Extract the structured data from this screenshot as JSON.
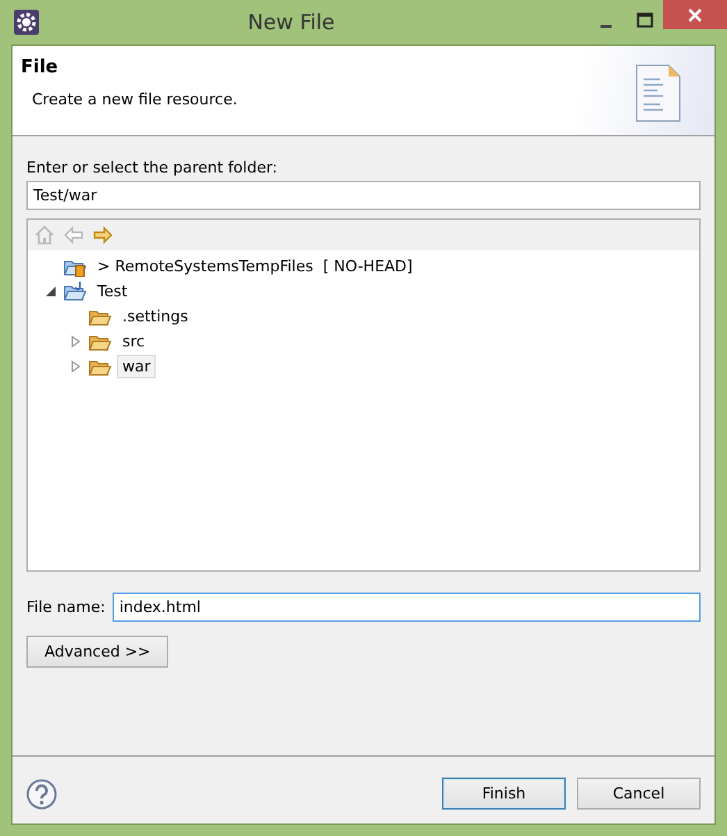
{
  "window": {
    "title": "New File"
  },
  "header": {
    "title": "File",
    "description": "Create a new file resource."
  },
  "parent_folder": {
    "label": "Enter or select the parent folder:",
    "value": "Test/war"
  },
  "tree": {
    "toolbar": [
      {
        "kind": "home",
        "disabled": true
      },
      {
        "kind": "back",
        "disabled": true
      },
      {
        "kind": "forward",
        "disabled": false
      }
    ],
    "items": [
      {
        "label": "> RemoteSystemsTempFiles  [ NO-HEAD]",
        "kind": "shared-project",
        "selected": false
      },
      {
        "label": "Test",
        "kind": "java-project",
        "expanded": true,
        "selected": false,
        "children": [
          {
            "label": ".settings",
            "kind": "folder",
            "selected": false
          },
          {
            "label": "src",
            "kind": "folder",
            "expanded": false,
            "selected": false
          },
          {
            "label": "war",
            "kind": "folder",
            "expanded": false,
            "selected": true
          }
        ]
      }
    ]
  },
  "file_name": {
    "label": "File name:",
    "value": "index.html"
  },
  "advanced_button": "Advanced >>",
  "buttons": [
    {
      "label": "Finish",
      "default": true
    },
    {
      "label": "Cancel",
      "default": false
    }
  ]
}
